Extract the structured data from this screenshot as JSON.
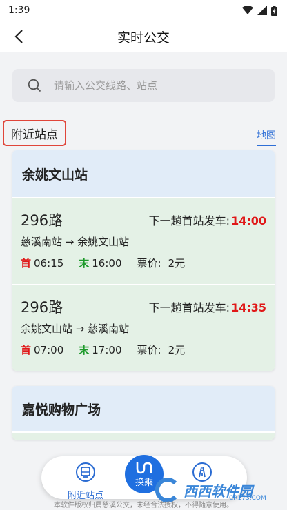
{
  "status_bar": {
    "time": "1:39"
  },
  "header": {
    "title": "实时公交"
  },
  "search": {
    "placeholder": "请输入公交线路、站点"
  },
  "nearby": {
    "title": "附近站点",
    "map_link": "地图"
  },
  "stations": [
    {
      "name": "余姚文山站",
      "routes": [
        {
          "number": "296路",
          "next_label": "下一趟首站发车:",
          "next_time": "14:00",
          "direction": "慈溪南站 → 余姚文山站",
          "first_mark": "首",
          "first_time": "06:15",
          "last_mark": "末",
          "last_time": "16:00",
          "fare_label": "票价:",
          "fare": "2元"
        },
        {
          "number": "296路",
          "next_label": "下一趟首站发车:",
          "next_time": "14:35",
          "direction": "余姚文山站 → 慈溪南站",
          "first_mark": "首",
          "first_time": "07:00",
          "last_mark": "末",
          "last_time": "17:00",
          "fare_label": "票价:",
          "fare": "2元"
        }
      ]
    },
    {
      "name": "嘉悦购物广场"
    }
  ],
  "bottom_nav": {
    "nearby_label": "附近站点",
    "transfer_label": "换乘"
  },
  "footer": {
    "note": "本软件版权归属慈溪公交，未经合法授权，不得随意使用。"
  },
  "watermark": {
    "text": "西西软件园",
    "sub": "CR173.COM"
  },
  "colors": {
    "accent_blue": "#1f6fe0",
    "highlight_red": "#e01818",
    "last_green": "#1d9a2b",
    "station_head_bg": "#e1ecf8",
    "route_bg": "#e4f1e6"
  }
}
